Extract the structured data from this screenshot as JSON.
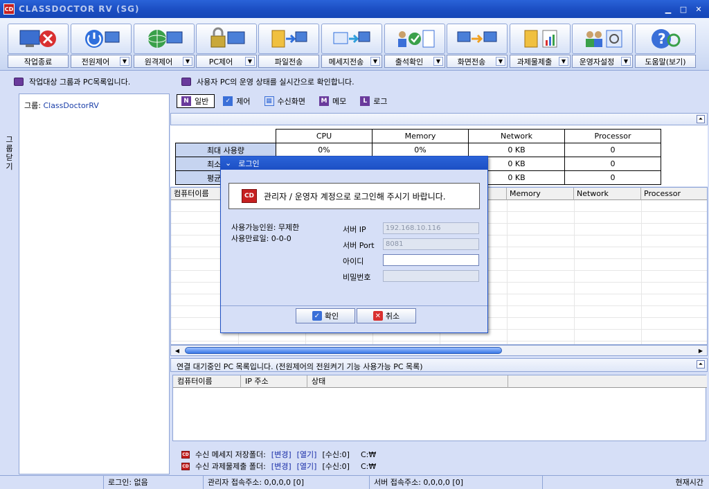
{
  "window": {
    "title": "CLASSDOCTOR RV (SG)",
    "app_icon": "CD",
    "min": "▁",
    "max": "□",
    "close": "✕"
  },
  "toolbar": [
    {
      "label": "작업종료",
      "icon": "shutdown-icon",
      "dropdown": false
    },
    {
      "label": "전원제어",
      "icon": "power-icon",
      "dropdown": true
    },
    {
      "label": "원격제어",
      "icon": "globe-network-icon",
      "dropdown": true
    },
    {
      "label": "PC제어",
      "icon": "lock-pc-icon",
      "dropdown": true
    },
    {
      "label": "파일전송",
      "icon": "file-transfer-icon",
      "dropdown": false
    },
    {
      "label": "메세지전송",
      "icon": "message-send-icon",
      "dropdown": true
    },
    {
      "label": "출석확인",
      "icon": "attendance-icon",
      "dropdown": true
    },
    {
      "label": "화면전송",
      "icon": "screen-transfer-icon",
      "dropdown": true
    },
    {
      "label": "과제물제출",
      "icon": "assignment-icon",
      "dropdown": true
    },
    {
      "label": "운영자설정",
      "icon": "admin-settings-icon",
      "dropdown": true
    },
    {
      "label": "도움말(보기)",
      "icon": "help-icon",
      "dropdown": false
    }
  ],
  "info": {
    "left": "작업대상 그룹과 PC목록입니다.",
    "right": "사용자 PC의 운영 상태를 실시간으로 확인합니다."
  },
  "sidebar": {
    "tab_chars": [
      "그",
      "룹",
      "닫",
      "기"
    ],
    "group_prefix": "그룹: ",
    "group_value": "ClassDoctorRV"
  },
  "tabs": [
    {
      "label": "일반",
      "letter": "N",
      "color": "#6a3b9c"
    },
    {
      "label": "제어",
      "letter": "✓",
      "color": "#3a6fd8"
    },
    {
      "label": "수신화면",
      "letter": "▦",
      "color": "#ffffff"
    },
    {
      "label": "메모",
      "letter": "M",
      "color": "#6a3b9c"
    },
    {
      "label": "로그",
      "letter": "L",
      "color": "#6a3b9c"
    }
  ],
  "stats": {
    "columns": [
      "CPU",
      "Memory",
      "Network",
      "Processor"
    ],
    "rows": [
      {
        "label": "최대 사용량",
        "values": [
          "0%",
          "0%",
          "0 KB",
          "0"
        ]
      },
      {
        "label": "최소 사용량",
        "values": [
          "0%",
          "0%",
          "0 KB",
          "0"
        ]
      },
      {
        "label": "평균 사용량",
        "values": [
          "0%",
          "0%",
          "0 KB",
          "0"
        ]
      }
    ]
  },
  "pc_grid": {
    "columns": [
      "컴퓨터이름",
      "",
      "",
      "",
      "",
      "",
      "Memory",
      "Network",
      "Processor"
    ]
  },
  "waiting": {
    "title": "연결 대기중인 PC 목록입니다. (전원제어의 전원켜기 기능 사용가능 PC 목록)",
    "columns": [
      "컴퓨터이름",
      "IP 주소",
      "상태",
      ""
    ]
  },
  "folders": [
    {
      "label": "수신 메세지 저장폴더:",
      "change": "[변경]",
      "open": "[열기]",
      "count": "[수신:0]",
      "path": "C:₩"
    },
    {
      "label": "수신 과제물제출 폴더:",
      "change": "[변경]",
      "open": "[열기]",
      "count": "[수신:0]",
      "path": "C:₩"
    }
  ],
  "status": {
    "login": "로그인: 없음",
    "admin_addr": "관리자 접속주소: 0,0,0,0 [0]",
    "server_addr": "서버 접속주소: 0,0,0,0 [0]",
    "time": "현재시간"
  },
  "dialog": {
    "title": "로그인",
    "banner": "관리자 / 운영자 계정으로 로그인해 주시기 바랍니다.",
    "available_users": "사용가능인원: 무제한",
    "expire": "사용만료일: 0-0-0",
    "server_ip_label": "서버 IP",
    "server_ip": "192.168.10.116",
    "server_port_label": "서버 Port",
    "server_port": "8081",
    "id_label": "아이디",
    "id_value": "",
    "pw_label": "비밀번호",
    "pw_value": "",
    "ok": "확인",
    "cancel": "취소"
  }
}
